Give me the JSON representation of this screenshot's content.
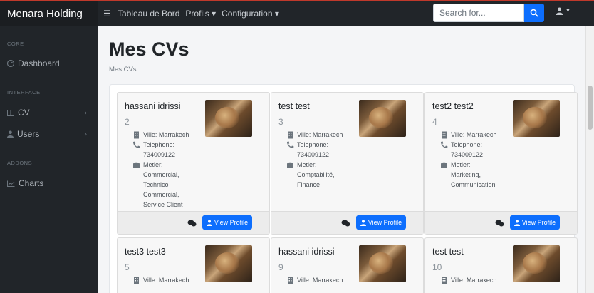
{
  "brand": "Menara Holding",
  "nav": {
    "items": [
      {
        "label": "Tableau de Bord"
      },
      {
        "label": "Profils ▾"
      },
      {
        "label": "Configuration ▾"
      }
    ]
  },
  "search": {
    "placeholder": "Search for..."
  },
  "sidebar": {
    "core": "CORE",
    "dashboard": "Dashboard",
    "interface": "INTERFACE",
    "cv": "CV",
    "users": "Users",
    "addons": "ADDONS",
    "charts": "Charts"
  },
  "page": {
    "title": "Mes CVs",
    "breadcrumb": "Mes CVs"
  },
  "labels": {
    "ville": "Ville: Marrakech",
    "telephone": "Telephone:",
    "metier": "Metier:",
    "view_profile": "View Profile"
  },
  "cards": [
    {
      "name": "hassani idrissi",
      "id": "2",
      "phone": "734009122",
      "metier": [
        "Commercial,",
        "Technico",
        "Commercial,",
        "Service Client"
      ]
    },
    {
      "name": "test test",
      "id": "3",
      "phone": "734009122",
      "metier": [
        "Comptabilité,",
        "Finance"
      ]
    },
    {
      "name": "test2 test2",
      "id": "4",
      "phone": "734009122",
      "metier": [
        "Marketing,",
        "Communication"
      ]
    },
    {
      "name": "test3 test3",
      "id": "5"
    },
    {
      "name": "hassani idrissi",
      "id": "9"
    },
    {
      "name": "test test",
      "id": "10"
    }
  ],
  "colors": {
    "accent": "#0d6efd",
    "dark": "#212529"
  }
}
